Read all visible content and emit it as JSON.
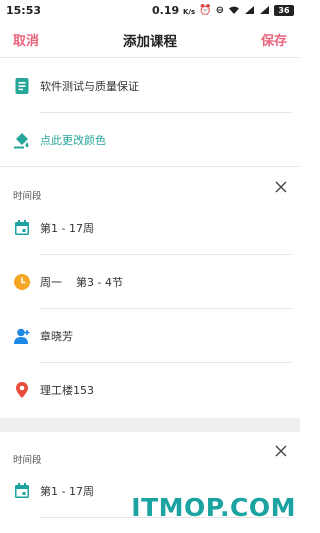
{
  "status": {
    "time": "15:53",
    "speed": "0.19",
    "speed_unit": "K/s",
    "battery": "36"
  },
  "header": {
    "cancel": "取消",
    "title": "添加课程",
    "save": "保存"
  },
  "course": {
    "name": "软件测试与质量保证",
    "color_action": "点此更改颜色"
  },
  "block1": {
    "label": "时间段",
    "weeks": "第1 - 17周",
    "day": "周一",
    "periods": "第3 - 4节",
    "teacher": "章晓芳",
    "room": "理工楼153"
  },
  "block2": {
    "label": "时间段",
    "weeks": "第1 - 17周"
  },
  "watermark": "ITMOP.COM",
  "colors": {
    "accent": "#e8647d",
    "teal": "#26a69a",
    "calendar": "#1aa3a1",
    "clock": "#f5a623",
    "person": "#1e88e5",
    "pin": "#e74c3c"
  }
}
